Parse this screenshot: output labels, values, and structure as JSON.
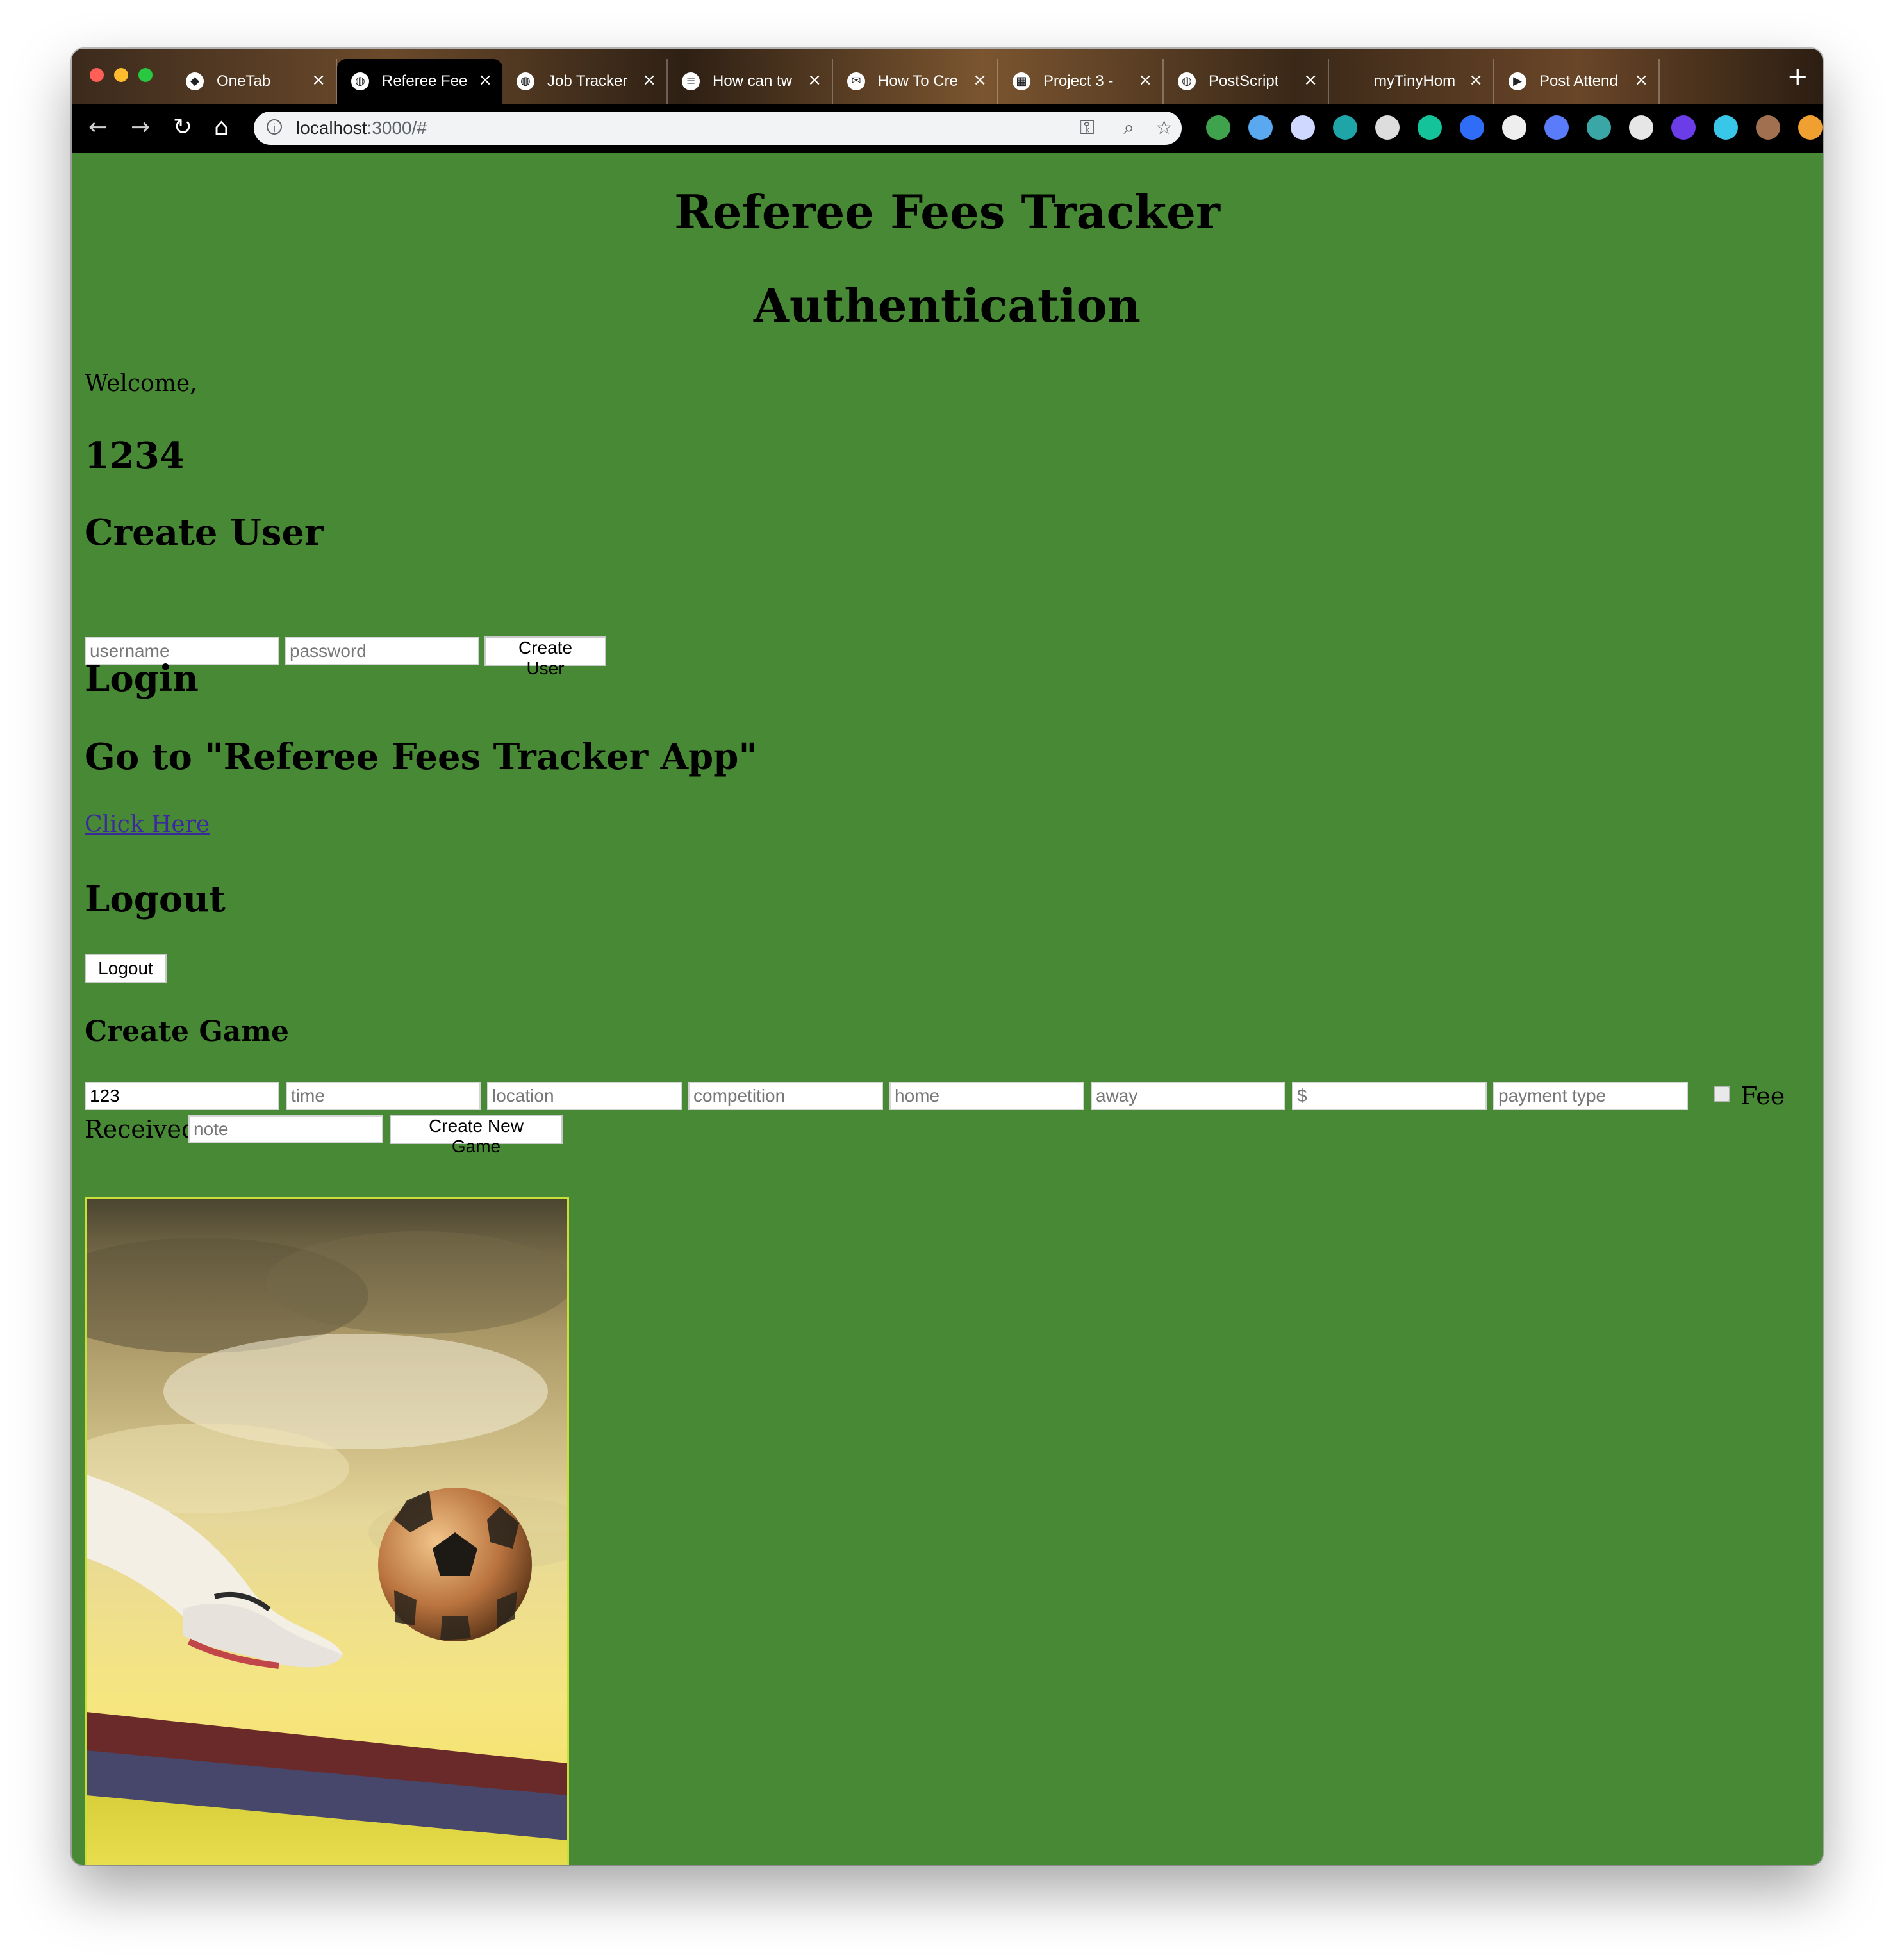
{
  "browser": {
    "tabs": [
      {
        "title": "OneTab",
        "icon": "onetab-icon",
        "active": false
      },
      {
        "title": "Referee Fee",
        "icon": "globe-icon",
        "active": true
      },
      {
        "title": "Job Tracker",
        "icon": "globe-icon",
        "active": false
      },
      {
        "title": "How can tw",
        "icon": "stackoverflow-icon",
        "active": false
      },
      {
        "title": "How To Cre",
        "icon": "mail-icon",
        "active": false
      },
      {
        "title": "Project 3 -",
        "icon": "sheets-icon",
        "active": false
      },
      {
        "title": "PostScript",
        "icon": "globe-icon",
        "active": false
      },
      {
        "title": "myTinyHom",
        "icon": "blank-icon",
        "active": false
      },
      {
        "title": "Post Attend",
        "icon": "zoom-icon",
        "active": false
      }
    ],
    "url_host": "localhost",
    "url_rest": ":3000/#",
    "extension_icons": [
      "evernote-icon",
      "diamond-icon",
      "react-icon",
      "circle-icon",
      "github-icon",
      "grammarly-icon",
      "bitly-icon",
      "speed-icon",
      "pen-icon",
      "palette-icon",
      "contrast-icon",
      "color-icon",
      "filter-icon",
      "avatar-icon",
      "metamask-icon"
    ]
  },
  "page": {
    "app_title": "Referee Fees Tracker",
    "auth_title": "Authentication",
    "welcome": "Welcome,",
    "username": "1234",
    "create_user": {
      "heading": "Create User",
      "username_placeholder": "username",
      "password_placeholder": "password",
      "button": "Create User"
    },
    "login_heading": "Login",
    "goto_heading": "Go to \"Referee Fees Tracker App\"",
    "click_here": "Click Here",
    "logout": {
      "heading": "Logout",
      "button": "Logout"
    },
    "create_game": {
      "heading": "Create Game",
      "date_value": "123",
      "time_placeholder": "time",
      "location_placeholder": "location",
      "competition_placeholder": "competition",
      "home_placeholder": "home",
      "away_placeholder": "away",
      "amount_placeholder": "$",
      "payment_type_placeholder": "payment type",
      "fee_received_label_1": "Fee",
      "fee_received_label_2": "Received",
      "note_placeholder": "note",
      "button": "Create New Game"
    }
  },
  "colors": {
    "page_background": "#488935",
    "link": "#3b2a9c"
  }
}
